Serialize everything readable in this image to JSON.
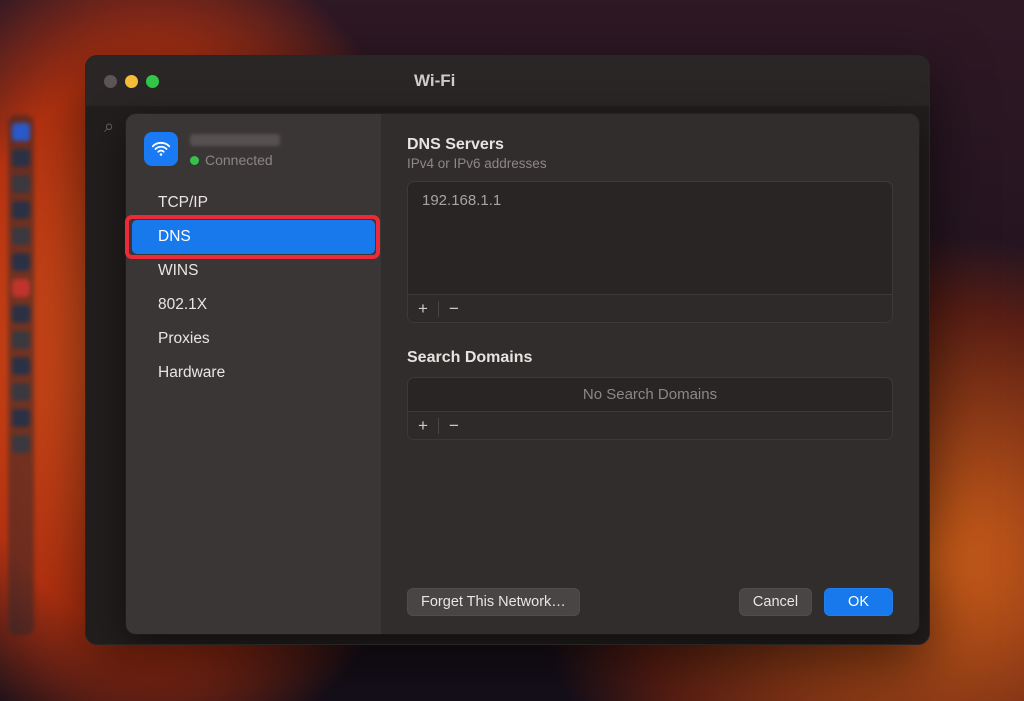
{
  "window": {
    "title": "Wi-Fi"
  },
  "network": {
    "status_label": "Connected"
  },
  "sidebar": {
    "items": [
      {
        "label": "TCP/IP"
      },
      {
        "label": "DNS"
      },
      {
        "label": "WINS"
      },
      {
        "label": "802.1X"
      },
      {
        "label": "Proxies"
      },
      {
        "label": "Hardware"
      }
    ],
    "selected_index": 1
  },
  "dns": {
    "section_title": "DNS Servers",
    "section_subtitle": "IPv4 or IPv6 addresses",
    "servers": [
      "192.168.1.1"
    ]
  },
  "search_domains": {
    "section_title": "Search Domains",
    "empty_label": "No Search Domains"
  },
  "footer": {
    "forget_label": "Forget This Network…",
    "cancel_label": "Cancel",
    "ok_label": "OK"
  },
  "icons": {
    "add": "+",
    "remove": "−"
  }
}
